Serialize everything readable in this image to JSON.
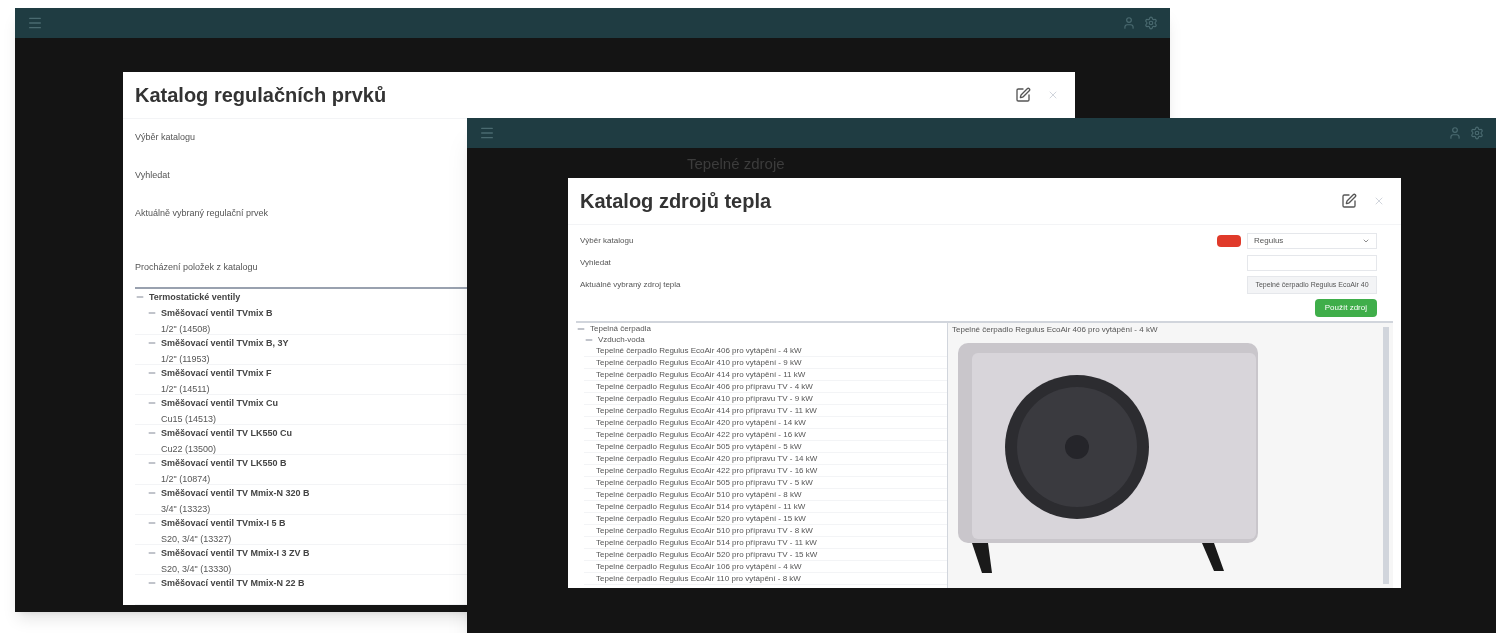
{
  "window_1": {
    "modal": {
      "title": "Katalog regulačních prvků",
      "fields": [
        {
          "label": "Výběr katalogu"
        },
        {
          "label": "Vyhledat"
        },
        {
          "label": "Aktuálně vybraný regulační prvek"
        },
        {
          "label": "Procházení položek z katalogu"
        }
      ],
      "tree": {
        "label": "Termostatické ventily",
        "expanded": true,
        "children": [
          {
            "label": "Směšovací ventil TVmix B",
            "detail": "1/2\" (14508)",
            "expanded": true
          },
          {
            "label": "Směšovací ventil TVmix B, 3Y",
            "detail": "1/2\" (11953)",
            "expanded": true
          },
          {
            "label": "Směšovací ventil TVmix F",
            "detail": "1/2\" (14511)",
            "expanded": true
          },
          {
            "label": "Směšovací ventil TVmix Cu",
            "detail": "Cu15 (14513)",
            "expanded": true
          },
          {
            "label": "Směšovací ventil TV LK550 Cu",
            "detail": "Cu22 (13500)",
            "expanded": true
          },
          {
            "label": "Směšovací ventil TV LK550 B",
            "detail": "1/2\" (10874)",
            "expanded": true
          },
          {
            "label": "Směšovací ventil TV Mmix-N 320 B",
            "detail": "3/4\" (13323)",
            "expanded": true
          },
          {
            "label": "Směšovací ventil TVmix-I 5 B",
            "detail": "S20, 3/4\" (13327)",
            "expanded": true
          },
          {
            "label": "Směšovací ventil TV Mmix-I 3 ZV B",
            "detail": "S20, 3/4\" (13330)",
            "expanded": true
          },
          {
            "label": "Směšovací ventil TV Mmix-N 22 B",
            "expanded": true
          }
        ]
      }
    }
  },
  "window_2": {
    "page_title": "Tepelné zdroje",
    "modal": {
      "title": "Katalog zdrojů tepla",
      "fields": [
        {
          "label": "Výběr katalogu",
          "kind": "select",
          "value": "Regulus"
        },
        {
          "label": "Vyhledat",
          "kind": "input"
        },
        {
          "label": "Aktuálně vybraný zdroj tepla",
          "kind": "button",
          "value": "Tepelné čerpadlo Regulus EcoAir 40"
        }
      ],
      "apply_button": "Použít zdroj",
      "tree": {
        "label": "Tepelná čerpadla",
        "expanded": true,
        "children": [
          {
            "label": "Vzduch-voda",
            "expanded": true,
            "children": [
              {
                "label": "Tepelné čerpadlo Regulus EcoAir 406 pro vytápění - 4 kW"
              },
              {
                "label": "Tepelné čerpadlo Regulus EcoAir 410 pro vytápění - 9 kW"
              },
              {
                "label": "Tepelné čerpadlo Regulus EcoAir 414 pro vytápění - 11 kW"
              },
              {
                "label": "Tepelné čerpadlo Regulus EcoAir 406 pro přípravu TV - 4 kW"
              },
              {
                "label": "Tepelné čerpadlo Regulus EcoAir 410 pro přípravu TV - 9 kW"
              },
              {
                "label": "Tepelné čerpadlo Regulus EcoAir 414 pro přípravu TV - 11 kW"
              },
              {
                "label": "Tepelné čerpadlo Regulus EcoAir 420 pro vytápění - 14 kW"
              },
              {
                "label": "Tepelné čerpadlo Regulus EcoAir 422 pro vytápění - 16 kW"
              },
              {
                "label": "Tepelné čerpadlo Regulus EcoAir 505 pro vytápění - 5 kW"
              },
              {
                "label": "Tepelné čerpadlo Regulus EcoAir 420 pro přípravu TV - 14 kW"
              },
              {
                "label": "Tepelné čerpadlo Regulus EcoAir 422 pro přípravu TV - 16 kW"
              },
              {
                "label": "Tepelné čerpadlo Regulus EcoAir 505 pro přípravu TV - 5 kW"
              },
              {
                "label": "Tepelné čerpadlo Regulus EcoAir 510 pro vytápění - 8 kW"
              },
              {
                "label": "Tepelné čerpadlo Regulus EcoAir 514 pro vytápění - 11 kW"
              },
              {
                "label": "Tepelné čerpadlo Regulus EcoAir 520 pro vytápění - 15 kW"
              },
              {
                "label": "Tepelné čerpadlo Regulus EcoAir 510 pro přípravu TV - 8 kW"
              },
              {
                "label": "Tepelné čerpadlo Regulus EcoAir 514 pro přípravu TV - 11 kW"
              },
              {
                "label": "Tepelné čerpadlo Regulus EcoAir 520 pro přípravu TV - 15 kW"
              },
              {
                "label": "Tepelné čerpadlo Regulus EcoAir 106 pro vytápění - 4 kW"
              },
              {
                "label": "Tepelné čerpadlo Regulus EcoAir 110 pro vytápění - 8 kW"
              }
            ]
          }
        ]
      },
      "preview": {
        "caption": "Tepelné čerpadlo Regulus EcoAir 406 pro vytápění - 4 kW"
      }
    }
  }
}
